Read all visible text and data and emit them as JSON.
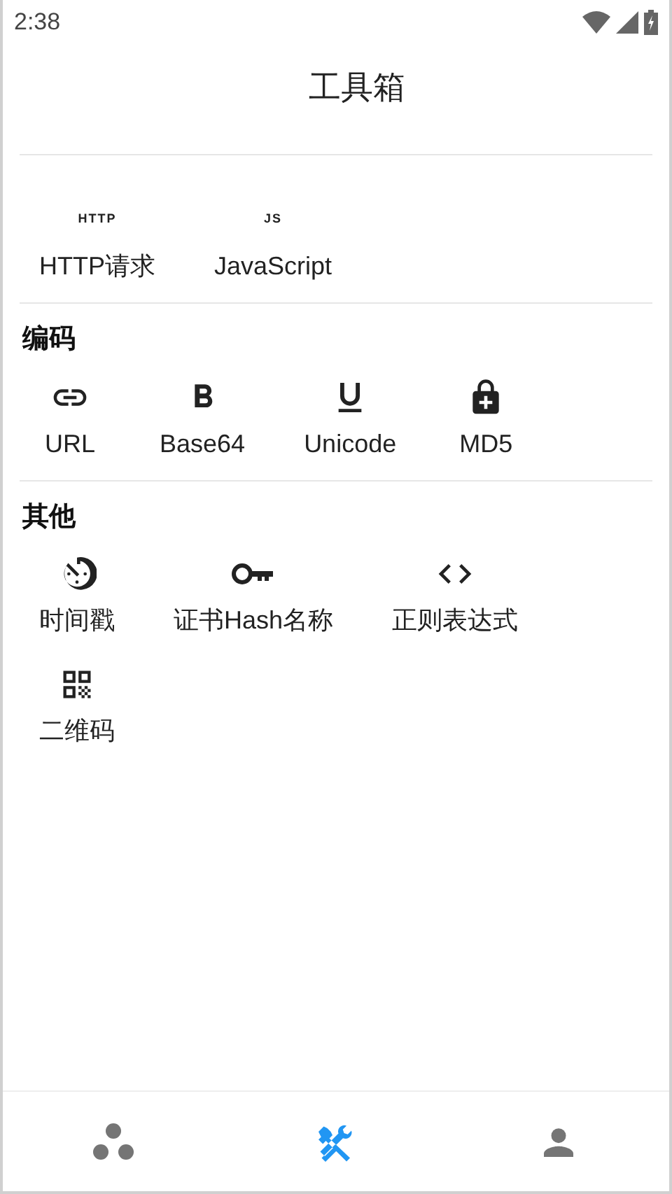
{
  "status_bar": {
    "time": "2:38"
  },
  "title": "工具箱",
  "sections": [
    {
      "items": [
        {
          "icon_text": "HTTP",
          "label": "HTTP请求"
        },
        {
          "icon_text": "JS",
          "label": "JavaScript"
        }
      ]
    },
    {
      "heading": "编码",
      "items": [
        {
          "label": "URL"
        },
        {
          "label": "Base64"
        },
        {
          "label": "Unicode"
        },
        {
          "label": "MD5"
        }
      ]
    },
    {
      "heading": "其他",
      "items": [
        {
          "label": "时间戳"
        },
        {
          "label": "证书Hash名称"
        },
        {
          "label": "正则表达式"
        },
        {
          "label": "二维码"
        }
      ]
    }
  ],
  "bottom_nav": [
    {
      "selected": false
    },
    {
      "selected": true
    },
    {
      "selected": false
    }
  ]
}
